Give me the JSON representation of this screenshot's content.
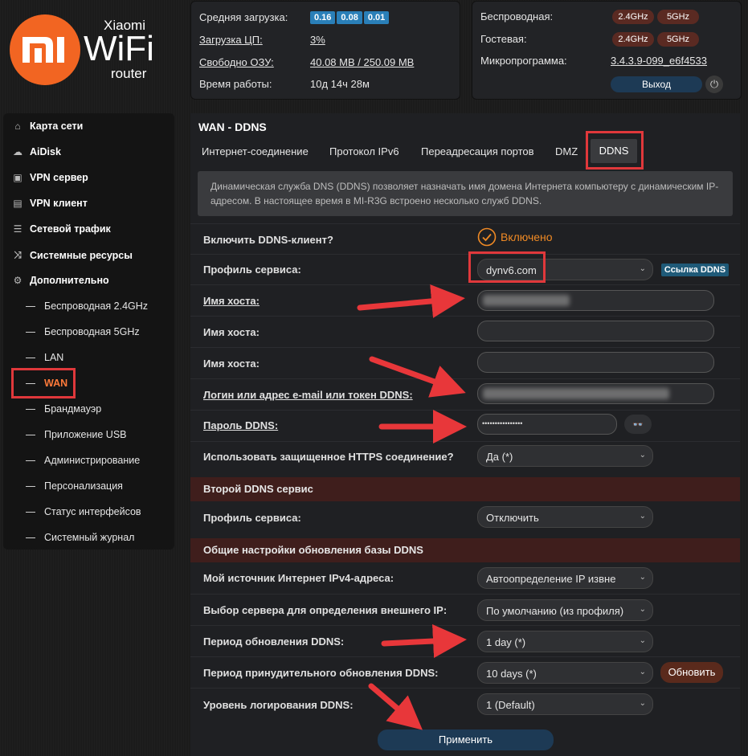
{
  "logo": {
    "mi": "mi",
    "brand": "Xiaomi",
    "wifi": "WiFi",
    "router": "router"
  },
  "status_left": {
    "load_label": "Средняя загрузка:",
    "load_values": [
      "0.16",
      "0.08",
      "0.01"
    ],
    "cpu_label": "Загрузка ЦП:",
    "cpu_value": "3%",
    "ram_label": "Свободно ОЗУ:",
    "ram_value": "40.08 MB / 250.09 MB",
    "uptime_label": "Время работы:",
    "uptime_value": "10д 14ч 28м"
  },
  "status_right": {
    "wireless_label": "Беспроводная:",
    "guest_label": "Гостевая:",
    "band_24": "2.4GHz",
    "band_5": "5GHz",
    "firmware_label": "Микропрограмма:",
    "firmware_value": "3.4.3.9-099_e6f4533",
    "exit_label": "Выход",
    "power_icon": "power-icon"
  },
  "sidebar": {
    "items": [
      {
        "label": "Карта сети",
        "icon": "home-icon"
      },
      {
        "label": "AiDisk",
        "icon": "cloud-icon"
      },
      {
        "label": "VPN сервер",
        "icon": "vpn-server-icon"
      },
      {
        "label": "VPN клиент",
        "icon": "vpn-client-icon"
      },
      {
        "label": "Сетевой трафик",
        "icon": "traffic-icon"
      },
      {
        "label": "Системные ресурсы",
        "icon": "shuffle-icon"
      },
      {
        "label": "Дополнительно",
        "icon": "gear-icon"
      }
    ],
    "subitems": [
      "Беспроводная 2.4GHz",
      "Беспроводная 5GHz",
      "LAN",
      "WAN",
      "Брандмауэр",
      "Приложение USB",
      "Администрирование",
      "Персонализация",
      "Статус интерфейсов",
      "Системный журнал"
    ]
  },
  "main": {
    "title": "WAN - DDNS",
    "tabs": [
      "Интернет-соединение",
      "Протокол IPv6",
      "Переадресация портов",
      "DMZ",
      "DDNS"
    ],
    "info": "Динамическая служба DNS (DDNS) позволяет назначать имя домена Интернета компьютеру с динамическим IP-адресом. В настоящее время в MI-R3G встроено несколько служб DDNS.",
    "rows": {
      "enable_label": "Включить DDNS-клиент?",
      "enable_value": "Включено",
      "profile_label": "Профиль сервиса:",
      "profile_value": "dynv6.com",
      "ddns_link": "Ссылка DDNS",
      "host_label": "Имя хоста:",
      "login_label": "Логин или адрес e-mail или токен DDNS:",
      "password_label": "Пароль DDNS:",
      "password_value": "••••••••••••••••",
      "https_label": "Использовать защищенное HTTPS соединение?",
      "https_value": "Да (*)"
    },
    "second_section": "Второй DDNS сервис",
    "second_profile_label": "Профиль сервиса:",
    "second_profile_value": "Отключить",
    "common_section": "Общие настройки обновления базы DDNS",
    "ipv4_label": "Мой источник Интернет IPv4-адреса:",
    "ipv4_value": "Автоопределение IP извне",
    "server_label": "Выбор сервера для определения внешнего IP:",
    "server_value": "По умолчанию (из профиля)",
    "period_label": "Период обновления DDNS:",
    "period_value": "1 day (*)",
    "force_label": "Период принудительного обновления DDNS:",
    "force_value": "10 days (*)",
    "refresh_label": "Обновить",
    "log_label": "Уровень логирования DDNS:",
    "log_value": "1 (Default)",
    "apply_label": "Применить"
  },
  "colors": {
    "accent": "#f26522",
    "highlight": "#e0383b",
    "section": "#3f1e1c",
    "button": "#1d3a55"
  }
}
